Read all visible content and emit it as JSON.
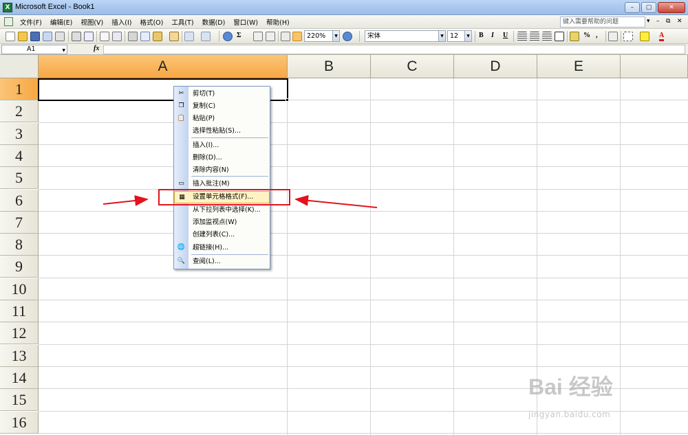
{
  "window": {
    "title": "Microsoft Excel - Book1",
    "app_icon_letter": "X",
    "buttons": [
      "–",
      "▢",
      "✕"
    ]
  },
  "menu": {
    "items": [
      "文件(F)",
      "编辑(E)",
      "视图(V)",
      "插入(I)",
      "格式(O)",
      "工具(T)",
      "数据(D)",
      "窗口(W)",
      "帮助(H)"
    ],
    "help_placeholder": "键入需要帮助的问题",
    "controls": [
      "▾",
      "–",
      "⧉",
      "✕"
    ]
  },
  "toolbar": {
    "zoom": "220%",
    "font_name": "宋体",
    "font_size": "12",
    "bold": "B",
    "italic": "I",
    "underline": "U",
    "sum": "Σ",
    "percent": "%",
    "comma": ","
  },
  "formula_bar": {
    "name_box": "A1",
    "fx": "fx",
    "value": ""
  },
  "grid": {
    "columns": [
      "A",
      "B",
      "C",
      "D",
      "E"
    ],
    "rows": [
      "1",
      "2",
      "3",
      "4",
      "5",
      "6",
      "7",
      "8",
      "9",
      "10",
      "11",
      "12",
      "13",
      "14",
      "15",
      "16"
    ],
    "active_cell": "A1"
  },
  "context_menu": {
    "items": [
      {
        "label": "剪切(T)",
        "icon": "scissors-icon",
        "glyph": "✂"
      },
      {
        "label": "复制(C)",
        "icon": "copy-icon",
        "glyph": "❐"
      },
      {
        "label": "粘贴(P)",
        "icon": "paste-icon",
        "glyph": "📋"
      },
      {
        "label": "选择性粘贴(S)...",
        "icon": "",
        "glyph": ""
      },
      {
        "label": "插入(I)...",
        "icon": "",
        "glyph": ""
      },
      {
        "label": "删除(D)...",
        "icon": "",
        "glyph": ""
      },
      {
        "label": "清除内容(N)",
        "icon": "",
        "glyph": ""
      },
      {
        "label": "插入批注(M)",
        "icon": "comment-icon",
        "glyph": "▭"
      },
      {
        "label": "设置单元格格式(F)...",
        "icon": "format-cells-icon",
        "glyph": "▦"
      },
      {
        "label": "从下拉列表中选择(K)...",
        "icon": "",
        "glyph": ""
      },
      {
        "label": "添加监视点(W)",
        "icon": "",
        "glyph": ""
      },
      {
        "label": "创建列表(C)...",
        "icon": "",
        "glyph": ""
      },
      {
        "label": "超链接(H)...",
        "icon": "hyperlink-icon",
        "glyph": "🌐"
      },
      {
        "label": "查阅(L)...",
        "icon": "lookup-icon",
        "glyph": "🔍"
      }
    ],
    "highlighted_index": 8
  },
  "annotation": {
    "color": "#e3121c"
  },
  "watermark": {
    "logo": "Bai 经验",
    "url": "jingyan.baidu.com"
  },
  "colors": {
    "header_active": "#f7a744",
    "menu_highlight": "#fff3c4",
    "annotation_red": "#e3121c"
  }
}
